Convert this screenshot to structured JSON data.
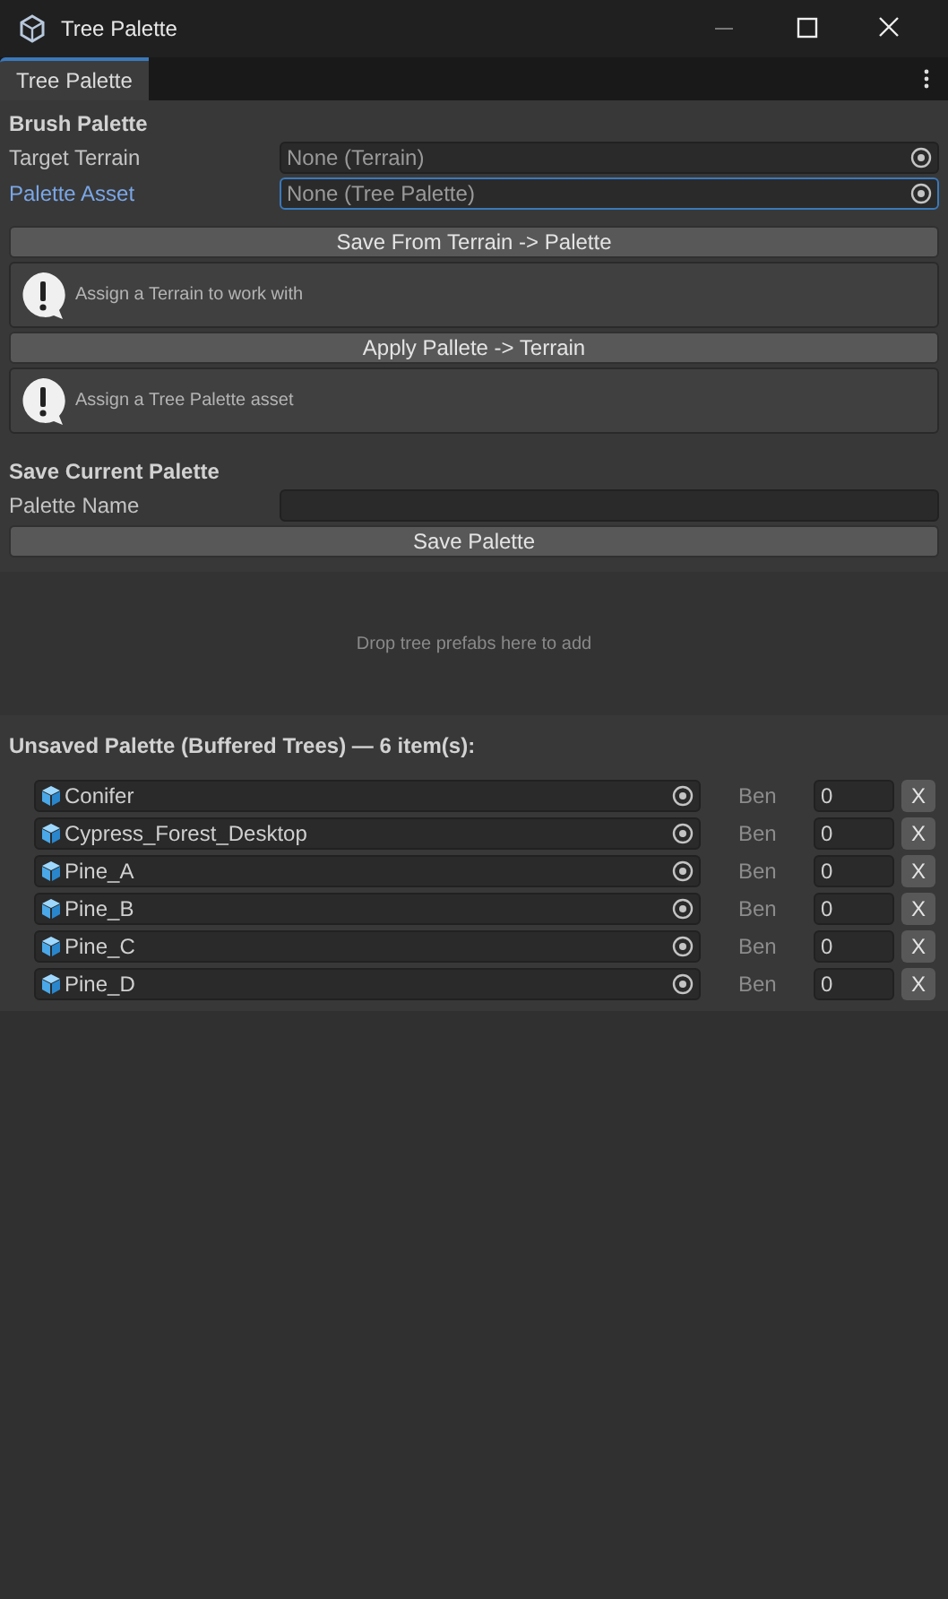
{
  "window": {
    "title": "Tree Palette"
  },
  "tabs": [
    {
      "label": "Tree Palette",
      "selected": true
    }
  ],
  "brush": {
    "heading": "Brush Palette",
    "fields": [
      {
        "label": "Target Terrain",
        "value": "None (Terrain)",
        "focused": false
      },
      {
        "label": "Palette Asset",
        "value": "None (Tree Palette)",
        "focused": true
      }
    ]
  },
  "actions": [
    {
      "button": "Save From Terrain -> Palette",
      "message": "Assign a Terrain to work with"
    },
    {
      "button": "Apply Pallete -> Terrain",
      "message": "Assign a Tree Palette asset"
    }
  ],
  "save": {
    "heading": "Save Current Palette",
    "name_label": "Palette Name",
    "button": "Save Palette"
  },
  "drop_area": {
    "hint": "Drop tree prefabs here to add"
  },
  "buffer": {
    "heading": "Unsaved Palette (Buffered Trees) — 6 item(s):",
    "items": [
      {
        "name": "Conifer",
        "bend_label": "Ben",
        "bend": "0",
        "remove": "X"
      },
      {
        "name": "Cypress_Forest_Desktop",
        "bend_label": "Ben",
        "bend": "0",
        "remove": "X"
      },
      {
        "name": "Pine_A",
        "bend_label": "Ben",
        "bend": "0",
        "remove": "X"
      },
      {
        "name": "Pine_B",
        "bend_label": "Ben",
        "bend": "0",
        "remove": "X"
      },
      {
        "name": "Pine_C",
        "bend_label": "Ben",
        "bend": "0",
        "remove": "X"
      },
      {
        "name": "Pine_D",
        "bend_label": "Ben",
        "bend": "0",
        "remove": "X"
      }
    ]
  }
}
